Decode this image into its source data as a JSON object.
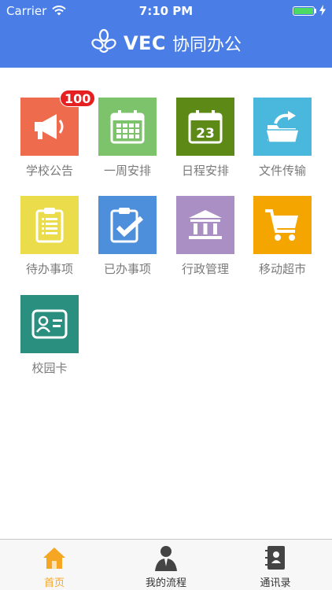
{
  "status_bar": {
    "carrier": "Carrier",
    "time": "7:10 PM"
  },
  "header": {
    "brand": "VEC",
    "title": "协同办公"
  },
  "tiles": [
    {
      "label": "学校公告",
      "color": "#ee6b4d",
      "icon": "megaphone-icon",
      "badge": "100"
    },
    {
      "label": "一周安排",
      "color": "#7dc36b",
      "icon": "calendar-grid-icon"
    },
    {
      "label": "日程安排",
      "color": "#5d8a17",
      "icon": "calendar-day-icon",
      "icon_text": "23"
    },
    {
      "label": "文件传输",
      "color": "#4ab8dc",
      "icon": "folder-share-icon"
    },
    {
      "label": "待办事项",
      "color": "#ebdc4b",
      "icon": "clipboard-list-icon"
    },
    {
      "label": "已办事项",
      "color": "#4d8fdb",
      "icon": "clipboard-check-icon"
    },
    {
      "label": "行政管理",
      "color": "#a98fc4",
      "icon": "government-building-icon"
    },
    {
      "label": "移动超市",
      "color": "#f5a500",
      "icon": "shopping-cart-icon"
    },
    {
      "label": "校园卡",
      "color": "#2b8f7f",
      "icon": "id-card-icon"
    }
  ],
  "tabbar": {
    "items": [
      {
        "label": "首页",
        "icon": "home-icon",
        "active": true
      },
      {
        "label": "我的流程",
        "icon": "person-icon",
        "active": false
      },
      {
        "label": "通讯录",
        "icon": "contacts-book-icon",
        "active": false
      }
    ],
    "active_color": "#f5a623"
  }
}
